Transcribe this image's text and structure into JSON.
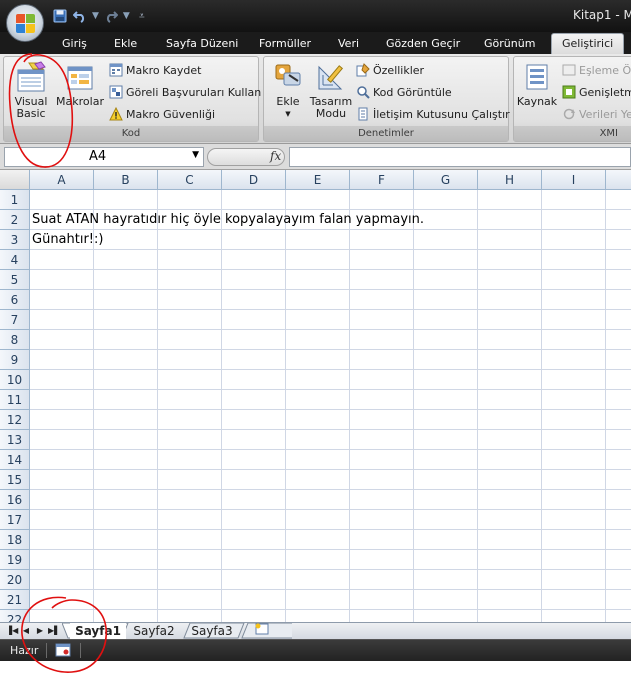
{
  "window": {
    "title": "Kitap1 - M"
  },
  "tabs": [
    {
      "label": "Giriş"
    },
    {
      "label": "Ekle"
    },
    {
      "label": "Sayfa Düzeni"
    },
    {
      "label": "Formüller"
    },
    {
      "label": "Veri"
    },
    {
      "label": "Gözden Geçir"
    },
    {
      "label": "Görünüm"
    },
    {
      "label": "Geliştirici",
      "active": true
    }
  ],
  "ribbon": {
    "kod": {
      "label": "Kod",
      "visual_basic_line1": "Visual",
      "visual_basic_line2": "Basic",
      "makrolar": "Makrolar",
      "makro_kaydet": "Makro Kaydet",
      "goreli": "Göreli Başvuruları Kullan",
      "makro_guvenligi": "Makro Güvenliği"
    },
    "denetimler": {
      "label": "Denetimler",
      "ekle": "Ekle",
      "tasarim_line1": "Tasarım",
      "tasarim_line2": "Modu",
      "ozellikler": "Özellikler",
      "kod_goruntule": "Kod Görüntüle",
      "iletisim": "İletişim Kutusunu Çalıştır"
    },
    "xml": {
      "label": "XMI",
      "kaynak": "Kaynak",
      "esleme": "Eşleme Öz",
      "genisletme": "Genişletm",
      "verileri": "Verileri Ye"
    }
  },
  "formula_bar": {
    "name_box": "A4",
    "fx": "fx",
    "content": ""
  },
  "grid": {
    "columns": [
      "A",
      "B",
      "C",
      "D",
      "E",
      "F",
      "G",
      "H",
      "I"
    ],
    "rows": [
      "1",
      "2",
      "3",
      "4",
      "5",
      "6",
      "7",
      "8",
      "9",
      "10",
      "11",
      "12",
      "13",
      "14",
      "15",
      "16",
      "17",
      "18",
      "19",
      "20",
      "21",
      "22"
    ],
    "cells": {
      "A2": "Suat ATAN hayratıdır hiç öyle kopyalayayım falan yapmayın.",
      "A3": "Günahtır!:)"
    }
  },
  "sheets": [
    {
      "label": "Sayfa1",
      "active": true
    },
    {
      "label": "Sayfa2"
    },
    {
      "label": "Sayfa3"
    }
  ],
  "status": {
    "text": "Hazır"
  },
  "colors": {
    "titlebar": "#1b1b1b",
    "annotation": "#e01010",
    "grid_line": "#d0d7e5",
    "header_border": "#9eb6ce"
  }
}
